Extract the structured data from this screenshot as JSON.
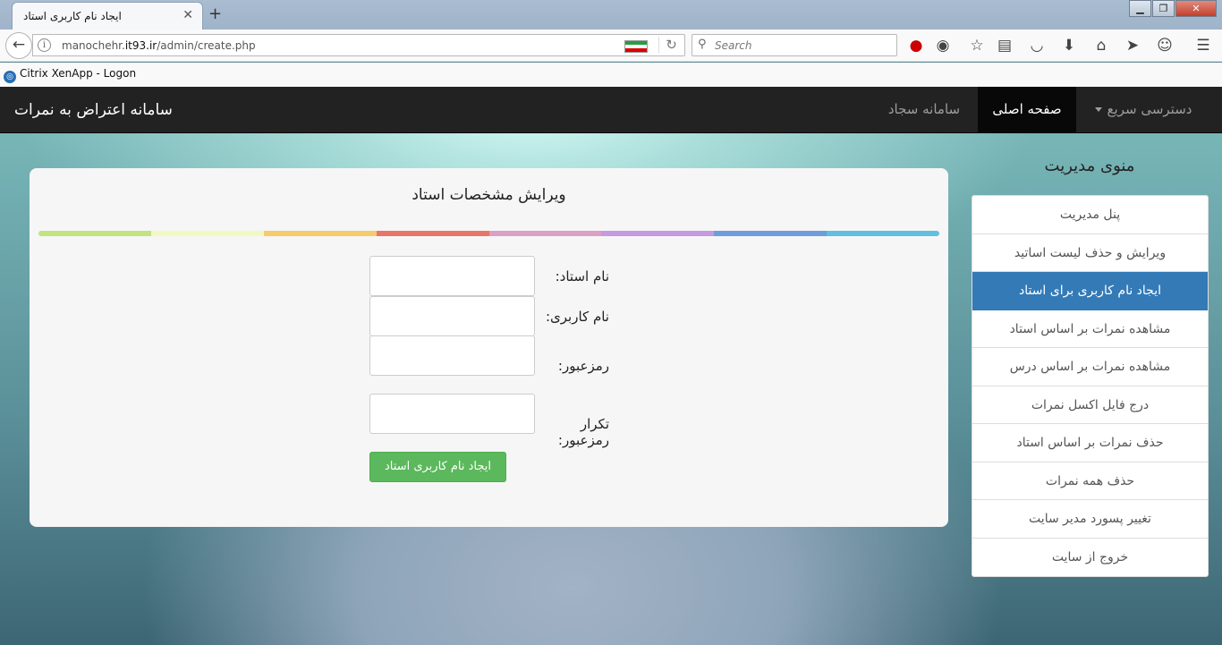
{
  "browser": {
    "tab_title": "ایجاد نام کاربری استاد",
    "url_host": "manochehr.it93.ir",
    "url_prefix": "manochehr.",
    "url_domain": "it93.ir",
    "url_path": "/admin/create.php",
    "search_placeholder": "Search",
    "bookmark_label": "Citrix XenApp - Logon"
  },
  "site": {
    "brand": "سامانه اعتراض به نمرات",
    "nav": {
      "quick_access": "دسترسی سریع",
      "home": "صفحه اصلی",
      "sajjad": "سامانه سجاد"
    }
  },
  "form": {
    "title": "ویرایش مشخصات استاد",
    "teacher_name_label": "نام استاد:",
    "username_label": "نام کاربری:",
    "password_label": "رمزعبور:",
    "password_repeat_label": "تکرار رمزعبور:",
    "submit_label": "ایجاد نام کاربری استاد",
    "teacher_name_value": "",
    "username_value": "",
    "password_value": "",
    "password_repeat_value": "",
    "rainbow_colors": [
      "#c3e37f",
      "#f1f8c3",
      "#f6cb6e",
      "#e8756a",
      "#dc9fc6",
      "#c49be0",
      "#6d9edb",
      "#60bfe0"
    ]
  },
  "sidebar": {
    "title": "منوی مدیریت",
    "items": [
      {
        "label": "پنل مدیریت",
        "active": false
      },
      {
        "label": "ویرایش و حذف لیست اساتید",
        "active": false
      },
      {
        "label": "ایجاد نام کاربری برای استاد",
        "active": true
      },
      {
        "label": "مشاهده نمرات بر اساس استاد",
        "active": false
      },
      {
        "label": "مشاهده نمرات بر اساس درس",
        "active": false
      },
      {
        "label": "درج فایل اکسل نمرات",
        "active": false
      },
      {
        "label": "حذف نمرات بر اساس استاد",
        "active": false
      },
      {
        "label": "حذف همه نمرات",
        "active": false
      },
      {
        "label": "تغییر پسورد مدیر سایت",
        "active": false
      },
      {
        "label": "خروج از سایت",
        "active": false
      }
    ]
  },
  "colors": {
    "navbar_bg": "#222222",
    "active_item": "#337ab7",
    "submit_button": "#5cb85c"
  }
}
